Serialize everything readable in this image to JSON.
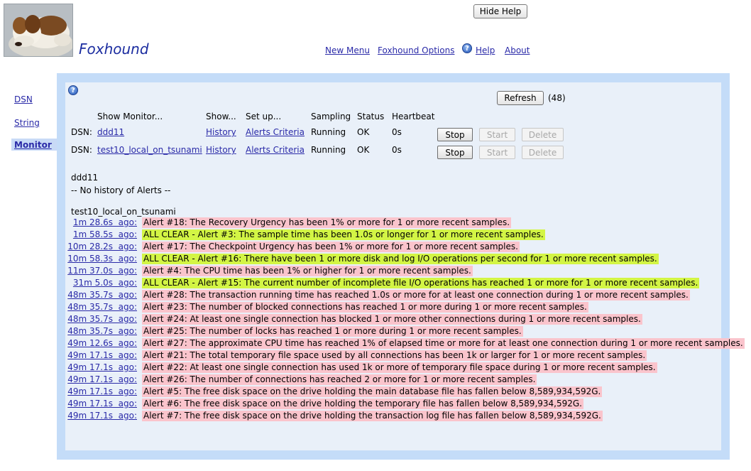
{
  "header": {
    "brand": "Foxhound",
    "hide_help_label": "Hide Help"
  },
  "topnav": {
    "new_menu": "New Menu",
    "options": "Foxhound Options",
    "help": "Help",
    "about": "About"
  },
  "sidenav": {
    "items": [
      "DSN",
      "String",
      "Monitor"
    ],
    "active": "Monitor"
  },
  "toolbar": {
    "refresh_label": "Refresh",
    "count": "(48)"
  },
  "table": {
    "headers": [
      "Show Monitor...",
      "Show...",
      "Set up...",
      "Sampling",
      "Status",
      "Heartbeat"
    ],
    "rows": [
      {
        "prefix": "DSN:",
        "name": "ddd11",
        "history": "History",
        "alerts": "Alerts Criteria",
        "sampling": "Running",
        "status": "OK",
        "heartbeat": "0s",
        "stop": "Stop",
        "start": "Start",
        "delete": "Delete"
      },
      {
        "prefix": "DSN:",
        "name": "test10_local_on_tsunami",
        "history": "History",
        "alerts": "Alerts Criteria",
        "sampling": "Running",
        "status": "OK",
        "heartbeat": "0s",
        "stop": "Stop",
        "start": "Start",
        "delete": "Delete"
      }
    ]
  },
  "history": {
    "section1_title": "ddd11",
    "section1_empty": "-- No history of Alerts --",
    "section2_title": "test10_local_on_tsunami",
    "alerts": [
      {
        "ago": "1m 28.6s  ago:",
        "type": "alert",
        "text": "Alert #18: The Recovery Urgency has been 1% or more for 1 or more recent samples."
      },
      {
        "ago": "1m 58.5s  ago:",
        "type": "clear",
        "text": "ALL CLEAR - Alert #3: The sample time has been 1.0s or longer for 1 or more recent samples."
      },
      {
        "ago": "10m 28.2s  ago:",
        "type": "alert",
        "text": "Alert #17: The Checkpoint Urgency has been 1% or more for 1 or more recent samples."
      },
      {
        "ago": "10m 58.3s  ago:",
        "type": "clear",
        "text": "ALL CLEAR - Alert #16: There have been 1 or more disk and log I/O operations per second for 1 or more recent samples."
      },
      {
        "ago": "11m 37.0s  ago:",
        "type": "alert",
        "text": "Alert #4: The CPU time has been 1% or higher for 1 or more recent samples."
      },
      {
        "ago": "31m 5.0s  ago:",
        "type": "clear",
        "text": "ALL CLEAR - Alert #15: The current number of incomplete file I/O operations has reached 1 or more for 1 or more recent samples."
      },
      {
        "ago": "48m 35.7s  ago:",
        "type": "alert",
        "text": "Alert #28: The transaction running time has reached 1.0s or more for at least one connection during 1 or more recent samples."
      },
      {
        "ago": "48m 35.7s  ago:",
        "type": "alert",
        "text": "Alert #23: The number of blocked connections has reached 1 or more during 1 or more recent samples."
      },
      {
        "ago": "48m 35.7s  ago:",
        "type": "alert",
        "text": "Alert #24: At least one single connection has blocked 1 or more other connections during 1 or more recent samples."
      },
      {
        "ago": "48m 35.7s  ago:",
        "type": "alert",
        "text": "Alert #25: The number of locks has reached 1 or more during 1 or more recent samples."
      },
      {
        "ago": "49m 12.6s  ago:",
        "type": "alert",
        "text": "Alert #27: The approximate CPU time has reached 1% of elapsed time or more for at least one connection during 1 or more recent samples."
      },
      {
        "ago": "49m 17.1s  ago:",
        "type": "alert",
        "text": "Alert #21: The total temporary file space used by all connections has been 1k or larger for 1 or more recent samples."
      },
      {
        "ago": "49m 17.1s  ago:",
        "type": "alert",
        "text": "Alert #22: At least one single connection has used 1k or more of temporary file space during 1 or more recent samples."
      },
      {
        "ago": "49m 17.1s  ago:",
        "type": "alert",
        "text": "Alert #26: The number of connections has reached 2 or more for 1 or more recent samples."
      },
      {
        "ago": "49m 17.1s  ago:",
        "type": "alert",
        "text": "Alert #5: The free disk space on the drive holding the main database file has fallen below 8,589,934,592G."
      },
      {
        "ago": "49m 17.1s  ago:",
        "type": "alert",
        "text": "Alert #6: The free disk space on the drive holding the temporary file has fallen below 8,589,934,592G."
      },
      {
        "ago": "49m 17.1s  ago:",
        "type": "alert",
        "text": "Alert #7: The free disk space on the drive holding the transaction log file has fallen below 8,589,934,592G."
      }
    ]
  },
  "colors": {
    "alert_bg": "#fac4cc",
    "clear_bg": "#d3f545",
    "link": "#2a2aa8",
    "brand": "#1c2da0",
    "panel_frame": "#c4dcf8",
    "panel_bg": "#e9f0f9"
  },
  "icons": {
    "logo": "sleeping-dog-photo",
    "help": "help-question-icon"
  }
}
